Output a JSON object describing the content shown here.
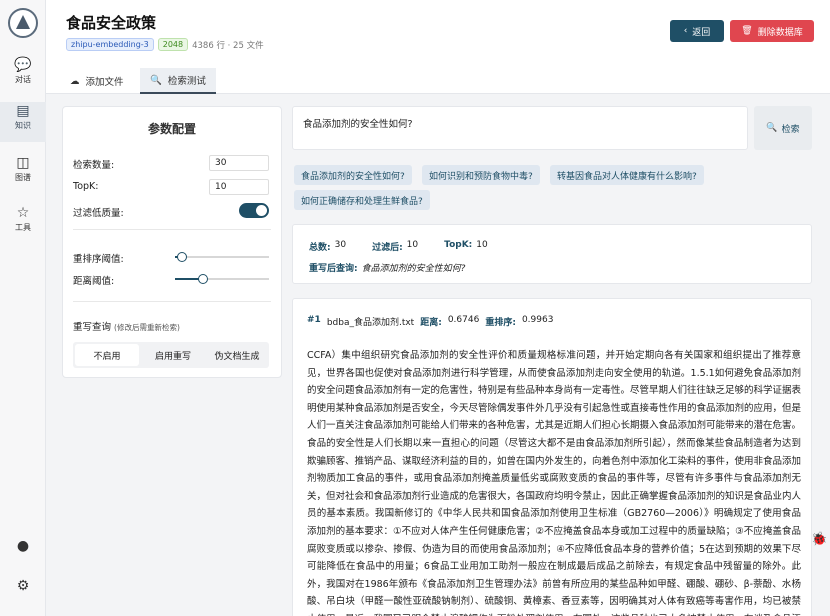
{
  "rail": {
    "items": [
      {
        "icon": "chat-icon",
        "glyph": "💬",
        "label": "对话"
      },
      {
        "icon": "knowledge-icon",
        "glyph": "▤",
        "label": "知识"
      },
      {
        "icon": "graph-icon",
        "glyph": "◫",
        "label": "图谱"
      },
      {
        "icon": "tools-icon",
        "glyph": "☆",
        "label": "工具"
      }
    ],
    "github_glyph": "●",
    "settings_glyph": "⚙"
  },
  "header": {
    "title": "食品安全政策",
    "embedding_badge": "zhipu-embedding-3",
    "dim_badge": "2048",
    "stats": "4386 行 · 25 文件",
    "back_label": "返回",
    "delete_label": "删除数据库"
  },
  "tabs": {
    "add_files": "添加文件",
    "retrieval_test": "检索测试"
  },
  "config": {
    "title": "参数配置",
    "retrieval_count_label": "检索数量:",
    "retrieval_count": "30",
    "topk_label": "TopK:",
    "topk": "10",
    "filter_label": "过滤低质量:",
    "filter_on": true,
    "rerank_label": "重排序阈值:",
    "rerank_value": 0.1,
    "distance_label": "距离阈值:",
    "distance_value": 0.3,
    "rewrite_label": "重写查询",
    "rewrite_hint": "(修改后需重新检索)",
    "rewrite_options": [
      "不启用",
      "启用重写",
      "伪文档生成"
    ]
  },
  "query": {
    "text": "食品添加剂的安全性如何?",
    "search_label": "检索",
    "suggestions": [
      "食品添加剂的安全性如何?",
      "如何识别和预防食物中毒?",
      "转基因食品对人体健康有什么影响?",
      "如何正确储存和处理生鲜食品?"
    ]
  },
  "stats": {
    "total_label": "总数:",
    "total": "30",
    "filtered_label": "过滤后:",
    "filtered": "10",
    "topk_label": "TopK:",
    "topk": "10",
    "rewritten_label": "重写后查询:",
    "rewritten": "食品添加剂的安全性如何?"
  },
  "result": {
    "index": "#1",
    "filename": "bdba_食品添加剂.txt",
    "distance_label": "距离:",
    "distance": "0.6746",
    "rerank_label": "重排序:",
    "rerank": "0.9963",
    "body": "CCFA）集中组织研究食品添加剂的安全性评价和质量规格标准问题，并开始定期向各有关国家和组织提出了推荐意见，世界各国也促使对食品添加剂进行科学管理，从而使食品添加剂走向安全使用的轨道。1.5.1如何避免食品添加剂的安全问题食品添加剂有一定的危害性，特别是有些品种本身尚有一定毒性。尽管早期人们往往缺乏足够的科学证据表明使用某种食品添加剂是否安全，今天尽管除偶发事件外几乎没有引起急性或直接毒性作用的食品添加剂的应用，但是人们一直关注食品添加剂可能给人们带来的各种危害，尤其是近期人们担心长期摄入食品添加剂可能带来的潜在危害。食品的安全性是人们长期以来一直担心的问题（尽管这大都不是由食品添加剂所引起），然而像某些食品制造者为达到欺骗顾客、推销产品、谋取经济利益的目的，如曾在国内外发生的，向着色剂中添加化工染料的事件，使用非食品添加剂物质加工食品的事件，或用食品添加剂掩盖质量低劣或腐败变质的食品的事件等，尽管有许多事件与食品添加剂无关，但对社会和食品添加剂行业造成的危害很大，各国政府均明令禁止，因此正确掌握食品添加剂的知识是食品业内人员的基本素质。我国新修订的《中华人民共和国食品添加剂使用卫生标准（GB2760—2006）》明确规定了使用食品添加剂的基本要求：①不应对人体产生任何健康危害；②不应掩盖食品本身或加工过程中的质量缺陷；③不应掩盖食品腐败变质或以掺杂、掺假、伪造为目的而使用食品添加剂；④不应降低食品本身的营养价值；5在达到预期的效果下尽可能降低在食品中的用量；6食品工业用加工助剂一般应在制成最后成品之前除去，有规定食品中残留量的除外。此外，我国对在1986年颁布《食品添加剂卫生管理办法》前曾有所应用的某些品种如甲醛、硼酸、硼砂、β-萘酚、水杨酸、吊白块（甲醛一酸性亚硫酸钠制剂）、硫酸铜、黄樟素、香豆素等，因明确其对人体有致癌等毒害作用，均已被禁止使用。最近，我国又已明令禁止溴酸钾作为面粉处理剂使用。在国外，这些品种也已大多被禁止使用。在谈及食品添加剂可以保持"
  },
  "colors": {
    "primary": "#1f4f66",
    "danger": "#e0464f",
    "chip_bg": "#dfe7f0"
  }
}
